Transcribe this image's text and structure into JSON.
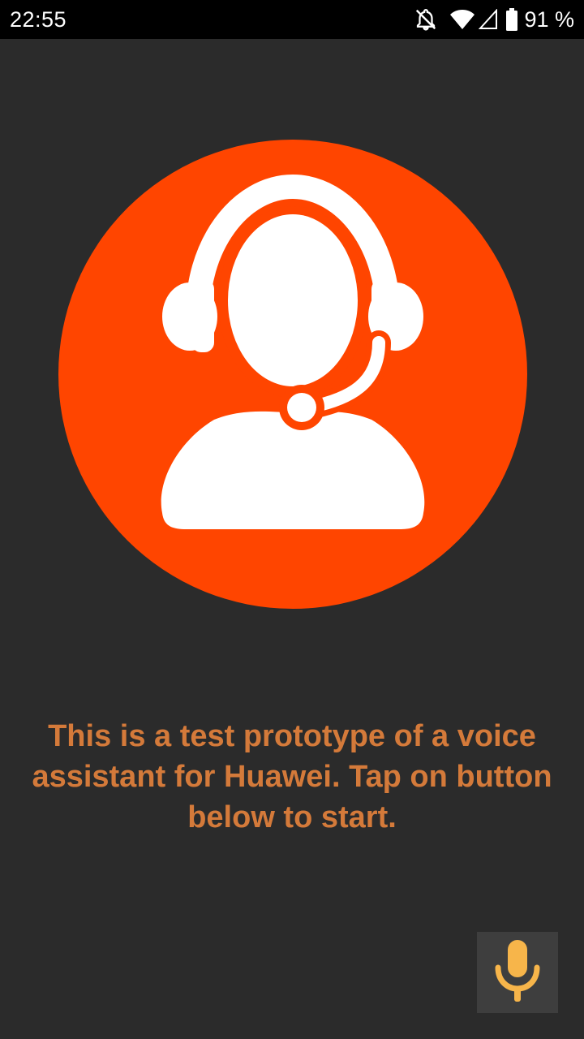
{
  "status_bar": {
    "time": "22:55",
    "battery_percent": "91 %",
    "icons": [
      "notifications-off-icon",
      "wifi-icon",
      "signal-icon",
      "battery-icon"
    ]
  },
  "main": {
    "avatar_icon": "customer-support-headset-icon",
    "intro_text": "This is a test prototype of a voice assistant for Huawei. Tap on button below to start.",
    "mic_button_icon": "microphone-icon"
  },
  "colors": {
    "background": "#2b2b2b",
    "status_bar": "#000000",
    "avatar_circle": "#ff4500",
    "text": "#d47a3a",
    "mic_icon": "#f7b54a",
    "mic_button_bg": "#3e3e3e"
  }
}
